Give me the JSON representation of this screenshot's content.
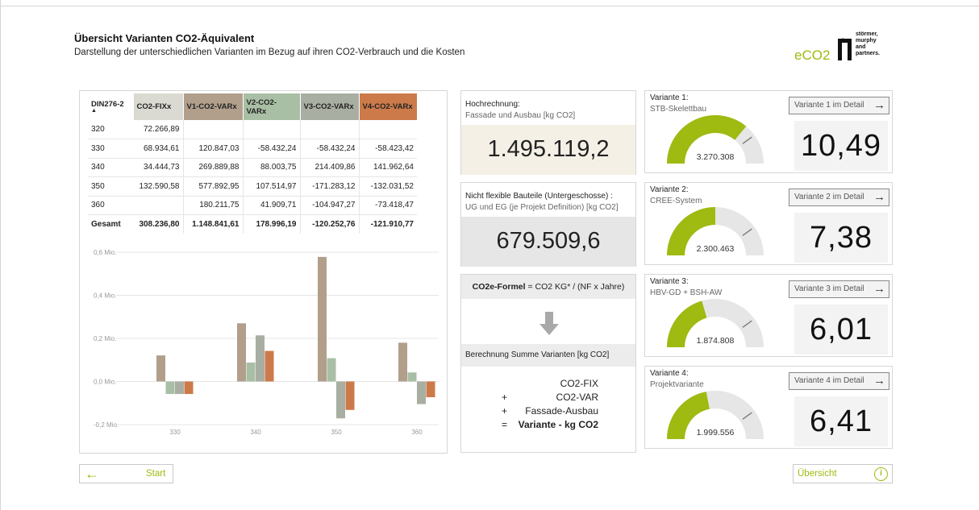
{
  "header": {
    "title": "Übersicht Varianten CO2-Äquivalent",
    "subtitle": "Darstellung der unterschiedlichen Varianten im Bezug auf ihren CO2-Verbrauch und die Kosten"
  },
  "logo": {
    "eco2_text": "eCO2",
    "company_line1": "störmer,",
    "company_line2": "murphy",
    "company_line3": "and",
    "company_line4": "partners."
  },
  "table": {
    "headers": [
      "DIN276-2",
      "CO2-FIXx",
      "V1-CO2-VARx",
      "V2-CO2-VARx",
      "V3-CO2-VARx",
      "V4-CO2-VARx"
    ],
    "rows": [
      [
        "320",
        "72.266,89",
        "",
        "",
        "",
        ""
      ],
      [
        "330",
        "68.934,61",
        "120.847,03",
        "-58.432,24",
        "-58.432,24",
        "-58.423,42"
      ],
      [
        "340",
        "34.444,73",
        "269.889,88",
        "88.003,75",
        "214.409,86",
        "141.962,64"
      ],
      [
        "350",
        "132.590,58",
        "577.892,95",
        "107.514,97",
        "-171.283,12",
        "-132.031,52"
      ],
      [
        "360",
        "",
        "180.211,75",
        "41.909,71",
        "-104.947,27",
        "-73.418,47"
      ]
    ],
    "total": [
      "Gesamt",
      "308.236,80",
      "1.148.841,61",
      "178.996,19",
      "-120.252,76",
      "-121.910,77"
    ]
  },
  "chart_data": {
    "type": "bar",
    "categories": [
      "330",
      "340",
      "350",
      "360"
    ],
    "series": [
      {
        "values": [
          0.121,
          0.27,
          0.578,
          0.18
        ],
        "color": "#b19f8c"
      },
      {
        "values": [
          -0.058,
          0.088,
          0.108,
          0.042
        ],
        "color": "#a9bfa5"
      },
      {
        "values": [
          -0.058,
          0.214,
          -0.171,
          -0.105
        ],
        "color": "#a9aea2"
      },
      {
        "values": [
          -0.058,
          0.142,
          -0.132,
          -0.073
        ],
        "color": "#cc7a4a"
      }
    ],
    "yticks": [
      "0,6 Mio.",
      "0,4 Mio.",
      "0,2 Mio.",
      "0,0 Mio.",
      "-0,2 Mio."
    ],
    "ylim": [
      -0.2,
      0.6
    ]
  },
  "hochrechnung": {
    "label": "Hochrechnung:",
    "sublabel": "Fassade und Ausbau [kg CO2]",
    "value": "1.495.119,2"
  },
  "nicht_flexibel": {
    "label": "Nicht flexible Bauteile (Untergeschosse) :",
    "sublabel": "UG und EG (je Projekt Definition) [kg CO2]",
    "value": "679.509,6"
  },
  "formel": {
    "header_bold": "CO2e-Formel",
    "header_rest": " = CO2 KG* / (NF x Jahre)",
    "sum_label": "Berechnung Summe Varianten [kg CO2]",
    "line1": "CO2-FIX",
    "line2_op": "+",
    "line2": "CO2-VAR",
    "line3_op": "+",
    "line3": "Fassade-Ausbau",
    "line4_op": "=",
    "line4": "Variante - kg CO2"
  },
  "variants": [
    {
      "title": "Variante 1:",
      "subtitle": "STB-Skelettbau",
      "button": "Variante 1 im Detail",
      "gauge_value": "3.270.308",
      "gauge_fraction": 0.72,
      "target_fraction": 0.8,
      "score": "10,49"
    },
    {
      "title": "Variante 2:",
      "subtitle": "CREE-System",
      "button": "Variante 2 im Detail",
      "gauge_value": "2.300.463",
      "gauge_fraction": 0.5,
      "target_fraction": 0.8,
      "score": "7,38"
    },
    {
      "title": "Variante 3:",
      "subtitle": "HBV-GD + BSH-AW",
      "button": "Variante 3 im Detail",
      "gauge_value": "1.874.808",
      "gauge_fraction": 0.41,
      "target_fraction": 0.8,
      "score": "6,01"
    },
    {
      "title": "Variante 4:",
      "subtitle": "Projektvariante",
      "button": "Variante 4 im Detail",
      "gauge_value": "1.999.556",
      "gauge_fraction": 0.44,
      "target_fraction": 0.8,
      "score": "6,41"
    }
  ],
  "nav": {
    "start_label": "Start",
    "uebersicht_label": "Übersicht"
  },
  "colors": {
    "accent": "#9fba10",
    "gauge_track": "#e6e6e6"
  }
}
